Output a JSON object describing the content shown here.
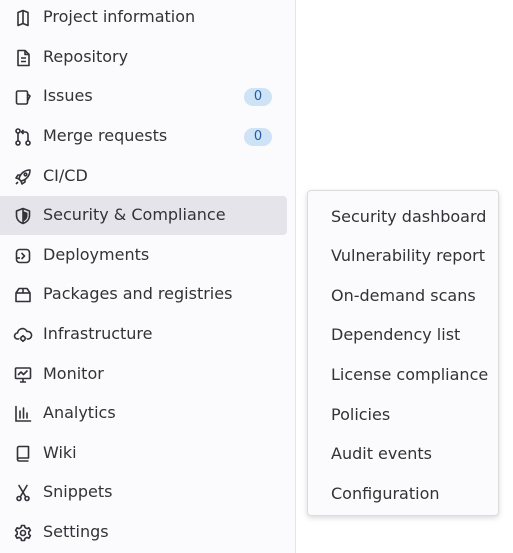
{
  "sidebar": {
    "items": [
      {
        "label": "Project information",
        "icon": "project-icon"
      },
      {
        "label": "Repository",
        "icon": "document-icon"
      },
      {
        "label": "Issues",
        "icon": "issues-icon",
        "badge": "0"
      },
      {
        "label": "Merge requests",
        "icon": "git-merge-icon",
        "badge": "0"
      },
      {
        "label": "CI/CD",
        "icon": "rocket-icon"
      },
      {
        "label": "Security & Compliance",
        "icon": "shield-icon",
        "active": true
      },
      {
        "label": "Deployments",
        "icon": "deployments-icon"
      },
      {
        "label": "Packages and registries",
        "icon": "package-icon"
      },
      {
        "label": "Infrastructure",
        "icon": "cloud-gear-icon"
      },
      {
        "label": "Monitor",
        "icon": "monitor-icon"
      },
      {
        "label": "Analytics",
        "icon": "chart-icon"
      },
      {
        "label": "Wiki",
        "icon": "book-icon"
      },
      {
        "label": "Snippets",
        "icon": "scissors-icon"
      },
      {
        "label": "Settings",
        "icon": "gear-icon"
      }
    ]
  },
  "flyout": {
    "items": [
      "Security dashboard",
      "Vulnerability report",
      "On-demand scans",
      "Dependency list",
      "License compliance",
      "Policies",
      "Audit events",
      "Configuration"
    ]
  },
  "colors": {
    "sidebar_bg": "#fbfafd",
    "active_bg": "#e6e4eb",
    "badge_bg": "#cfe3f6",
    "badge_text": "#1f5da0",
    "text": "#333238"
  }
}
